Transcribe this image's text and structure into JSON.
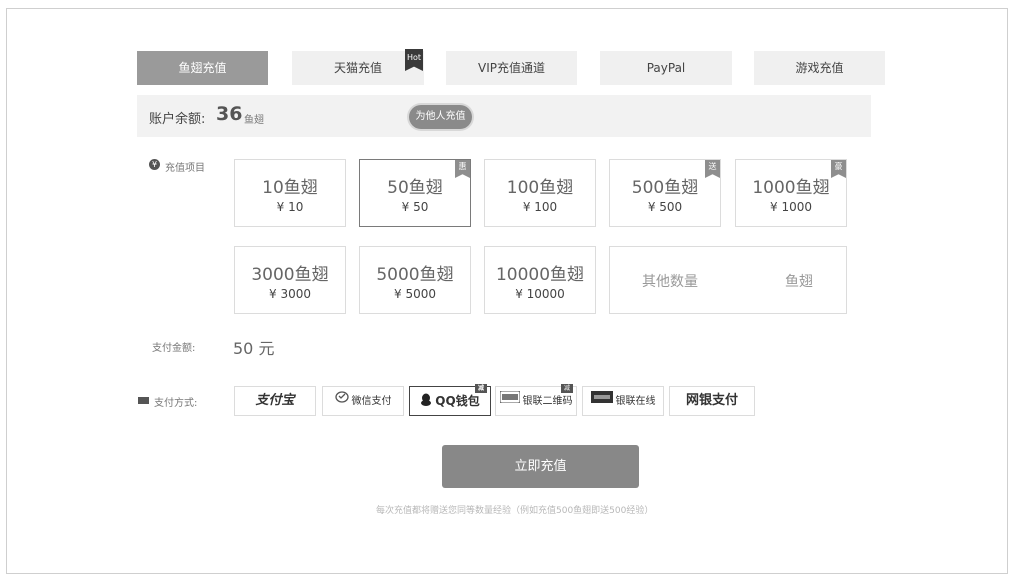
{
  "tabs": [
    {
      "label": "鱼翅充值",
      "active": true
    },
    {
      "label": "天猫充值",
      "active": false
    },
    {
      "label": "VIP充值通道",
      "active": false
    },
    {
      "label": "PayPal",
      "active": false
    },
    {
      "label": "游戏充值",
      "active": false
    }
  ],
  "hot_badge": "Hot",
  "balance": {
    "label": "账户余额:",
    "amount": "36",
    "unit": "鱼翅",
    "gift_button": "为他人充值"
  },
  "recharge_label": "充值项目",
  "yen_symbol": "¥",
  "packages": [
    {
      "amount": "10鱼翅",
      "price": "¥ 10",
      "badge": ""
    },
    {
      "amount": "50鱼翅",
      "price": "¥ 50",
      "badge": "惠",
      "selected": true
    },
    {
      "amount": "100鱼翅",
      "price": "¥ 100",
      "badge": ""
    },
    {
      "amount": "500鱼翅",
      "price": "¥ 500",
      "badge": "送"
    },
    {
      "amount": "1000鱼翅",
      "price": "¥ 1000",
      "badge": "豪"
    },
    {
      "amount": "3000鱼翅",
      "price": "¥ 3000",
      "badge": ""
    },
    {
      "amount": "5000鱼翅",
      "price": "¥ 5000",
      "badge": ""
    },
    {
      "amount": "10000鱼翅",
      "price": "¥ 10000",
      "badge": ""
    }
  ],
  "other_amount": {
    "placeholder": "其他数量",
    "unit": "鱼翅"
  },
  "pay_amount": {
    "label": "支付金额:",
    "value": "50 元"
  },
  "pay_method": {
    "label": "支付方式:",
    "options": [
      {
        "label": "支付宝",
        "selected": false,
        "badge": ""
      },
      {
        "label": "微信支付",
        "selected": false,
        "badge": ""
      },
      {
        "label": "QQ钱包",
        "selected": true,
        "badge": "减"
      },
      {
        "label": "银联二维码",
        "selected": false,
        "badge": "减"
      },
      {
        "label": "银联在线",
        "selected": false,
        "badge": ""
      },
      {
        "label": "网银支付",
        "selected": false,
        "badge": ""
      }
    ]
  },
  "submit_label": "立即充值",
  "note": "每次充值都将赠送您同等数量经验（例如充值500鱼翅即送500经验）"
}
